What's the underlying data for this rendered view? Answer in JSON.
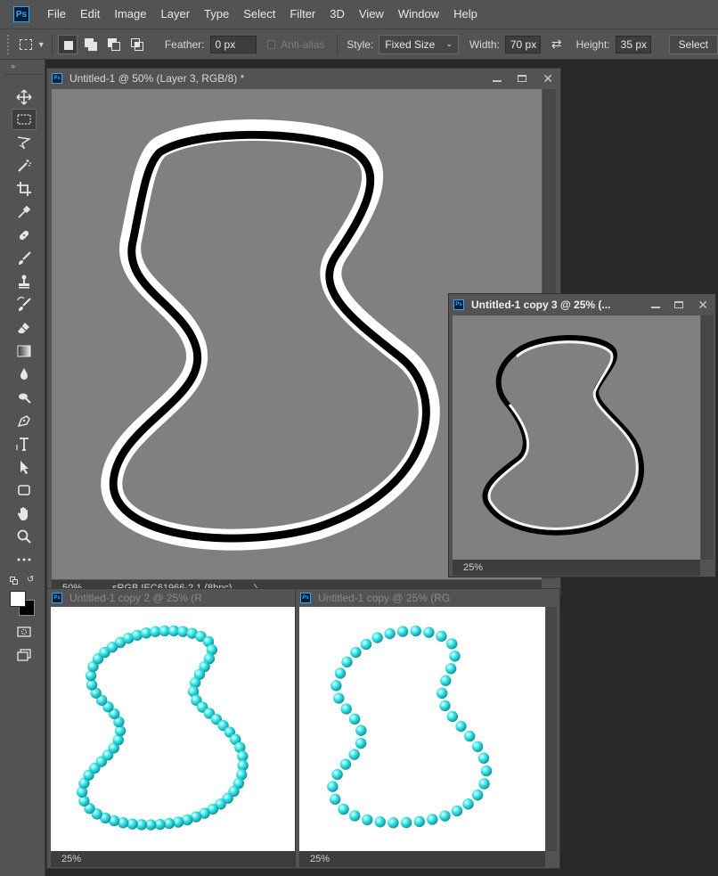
{
  "app": {
    "logo": "Ps",
    "menu": [
      "File",
      "Edit",
      "Image",
      "Layer",
      "Type",
      "Select",
      "Filter",
      "3D",
      "View",
      "Window",
      "Help"
    ]
  },
  "options": {
    "feather_label": "Feather:",
    "feather_value": "0 px",
    "antialias_label": "Anti-alias",
    "style_label": "Style:",
    "style_value": "Fixed Size",
    "width_label": "Width:",
    "width_value": "70 px",
    "height_label": "Height:",
    "height_value": "35 px",
    "select_button": "Select"
  },
  "tools": [
    "move-tool-icon",
    "rectangular-marquee-tool-icon",
    "lasso-tool-icon",
    "magic-wand-tool-icon",
    "crop-tool-icon",
    "eyedropper-tool-icon",
    "healing-brush-tool-icon",
    "brush-tool-icon",
    "clone-stamp-tool-icon",
    "history-brush-tool-icon",
    "eraser-tool-icon",
    "gradient-tool-icon",
    "blur-tool-icon",
    "dodge-tool-icon",
    "pen-tool-icon",
    "type-tool-icon",
    "path-selection-tool-icon",
    "shape-tool-icon",
    "hand-tool-icon",
    "zoom-tool-icon",
    "more-tools-icon"
  ],
  "colors": {
    "foreground": "#ffffff",
    "background": "#000000",
    "bead": "#33e6e6",
    "canvas_gray": "#808080"
  },
  "documents": {
    "main": {
      "title": "Untitled-1 @ 50% (Layer 3, RGB/8) *",
      "zoom": "50%",
      "profile": "sRGB IEC61966-2.1 (8bpc)",
      "arrow": "〉"
    },
    "copy3": {
      "title": "Untitled-1 copy 3 @ 25% (...",
      "zoom": "25%"
    },
    "copy2": {
      "title": "Untitled-1 copy 2 @ 25% (R",
      "zoom": "25%"
    },
    "copy1": {
      "title": "Untitled-1 copy @ 25% (RG",
      "zoom": "25%"
    }
  }
}
